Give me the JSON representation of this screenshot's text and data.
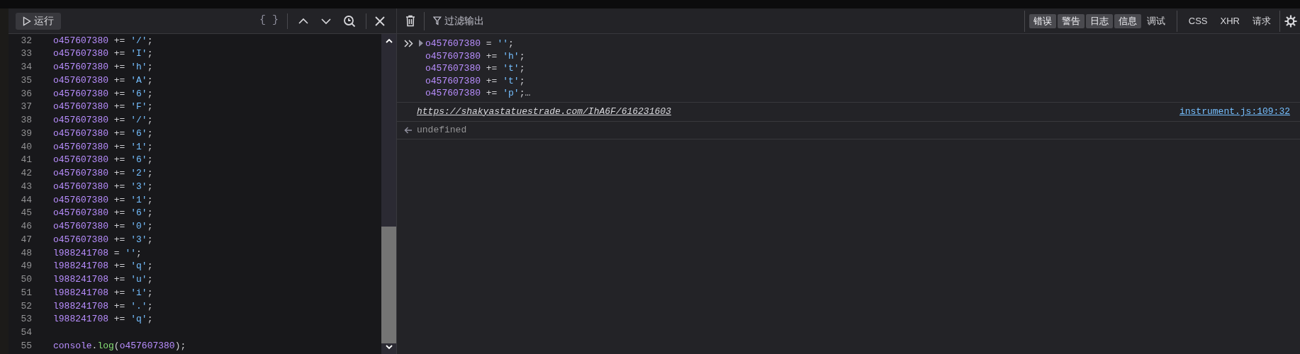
{
  "editor": {
    "run_button": "运行",
    "format_button": "{ }",
    "lines": [
      {
        "number": "32",
        "tokens": [
          {
            "text": "o457607380",
            "kind": "var"
          },
          {
            "text": " += ",
            "kind": "op"
          },
          {
            "text": "'/'",
            "kind": "str"
          },
          {
            "text": ";",
            "kind": "op"
          }
        ]
      },
      {
        "number": "33",
        "tokens": [
          {
            "text": "o457607380",
            "kind": "var"
          },
          {
            "text": " += ",
            "kind": "op"
          },
          {
            "text": "'I'",
            "kind": "str"
          },
          {
            "text": ";",
            "kind": "op"
          }
        ]
      },
      {
        "number": "34",
        "tokens": [
          {
            "text": "o457607380",
            "kind": "var"
          },
          {
            "text": " += ",
            "kind": "op"
          },
          {
            "text": "'h'",
            "kind": "str"
          },
          {
            "text": ";",
            "kind": "op"
          }
        ]
      },
      {
        "number": "35",
        "tokens": [
          {
            "text": "o457607380",
            "kind": "var"
          },
          {
            "text": " += ",
            "kind": "op"
          },
          {
            "text": "'A'",
            "kind": "str"
          },
          {
            "text": ";",
            "kind": "op"
          }
        ]
      },
      {
        "number": "36",
        "tokens": [
          {
            "text": "o457607380",
            "kind": "var"
          },
          {
            "text": " += ",
            "kind": "op"
          },
          {
            "text": "'6'",
            "kind": "str"
          },
          {
            "text": ";",
            "kind": "op"
          }
        ]
      },
      {
        "number": "37",
        "tokens": [
          {
            "text": "o457607380",
            "kind": "var"
          },
          {
            "text": " += ",
            "kind": "op"
          },
          {
            "text": "'F'",
            "kind": "str"
          },
          {
            "text": ";",
            "kind": "op"
          }
        ]
      },
      {
        "number": "38",
        "tokens": [
          {
            "text": "o457607380",
            "kind": "var"
          },
          {
            "text": " += ",
            "kind": "op"
          },
          {
            "text": "'/'",
            "kind": "str"
          },
          {
            "text": ";",
            "kind": "op"
          }
        ]
      },
      {
        "number": "39",
        "tokens": [
          {
            "text": "o457607380",
            "kind": "var"
          },
          {
            "text": " += ",
            "kind": "op"
          },
          {
            "text": "'6'",
            "kind": "str"
          },
          {
            "text": ";",
            "kind": "op"
          }
        ]
      },
      {
        "number": "40",
        "tokens": [
          {
            "text": "o457607380",
            "kind": "var"
          },
          {
            "text": " += ",
            "kind": "op"
          },
          {
            "text": "'1'",
            "kind": "str"
          },
          {
            "text": ";",
            "kind": "op"
          }
        ]
      },
      {
        "number": "41",
        "tokens": [
          {
            "text": "o457607380",
            "kind": "var"
          },
          {
            "text": " += ",
            "kind": "op"
          },
          {
            "text": "'6'",
            "kind": "str"
          },
          {
            "text": ";",
            "kind": "op"
          }
        ]
      },
      {
        "number": "42",
        "tokens": [
          {
            "text": "o457607380",
            "kind": "var"
          },
          {
            "text": " += ",
            "kind": "op"
          },
          {
            "text": "'2'",
            "kind": "str"
          },
          {
            "text": ";",
            "kind": "op"
          }
        ]
      },
      {
        "number": "43",
        "tokens": [
          {
            "text": "o457607380",
            "kind": "var"
          },
          {
            "text": " += ",
            "kind": "op"
          },
          {
            "text": "'3'",
            "kind": "str"
          },
          {
            "text": ";",
            "kind": "op"
          }
        ]
      },
      {
        "number": "44",
        "tokens": [
          {
            "text": "o457607380",
            "kind": "var"
          },
          {
            "text": " += ",
            "kind": "op"
          },
          {
            "text": "'1'",
            "kind": "str"
          },
          {
            "text": ";",
            "kind": "op"
          }
        ]
      },
      {
        "number": "45",
        "tokens": [
          {
            "text": "o457607380",
            "kind": "var"
          },
          {
            "text": " += ",
            "kind": "op"
          },
          {
            "text": "'6'",
            "kind": "str"
          },
          {
            "text": ";",
            "kind": "op"
          }
        ]
      },
      {
        "number": "46",
        "tokens": [
          {
            "text": "o457607380",
            "kind": "var"
          },
          {
            "text": " += ",
            "kind": "op"
          },
          {
            "text": "'0'",
            "kind": "str"
          },
          {
            "text": ";",
            "kind": "op"
          }
        ]
      },
      {
        "number": "47",
        "tokens": [
          {
            "text": "o457607380",
            "kind": "var"
          },
          {
            "text": " += ",
            "kind": "op"
          },
          {
            "text": "'3'",
            "kind": "str"
          },
          {
            "text": ";",
            "kind": "op"
          }
        ]
      },
      {
        "number": "48",
        "tokens": [
          {
            "text": "l988241708",
            "kind": "var"
          },
          {
            "text": " = ",
            "kind": "op"
          },
          {
            "text": "''",
            "kind": "str"
          },
          {
            "text": ";",
            "kind": "op"
          }
        ]
      },
      {
        "number": "49",
        "tokens": [
          {
            "text": "l988241708",
            "kind": "var"
          },
          {
            "text": " += ",
            "kind": "op"
          },
          {
            "text": "'q'",
            "kind": "str"
          },
          {
            "text": ";",
            "kind": "op"
          }
        ]
      },
      {
        "number": "50",
        "tokens": [
          {
            "text": "l988241708",
            "kind": "var"
          },
          {
            "text": " += ",
            "kind": "op"
          },
          {
            "text": "'u'",
            "kind": "str"
          },
          {
            "text": ";",
            "kind": "op"
          }
        ]
      },
      {
        "number": "51",
        "tokens": [
          {
            "text": "l988241708",
            "kind": "var"
          },
          {
            "text": " += ",
            "kind": "op"
          },
          {
            "text": "'i'",
            "kind": "str"
          },
          {
            "text": ";",
            "kind": "op"
          }
        ]
      },
      {
        "number": "52",
        "tokens": [
          {
            "text": "l988241708",
            "kind": "var"
          },
          {
            "text": " += ",
            "kind": "op"
          },
          {
            "text": "'.'",
            "kind": "str"
          },
          {
            "text": ";",
            "kind": "op"
          }
        ]
      },
      {
        "number": "53",
        "tokens": [
          {
            "text": "l988241708",
            "kind": "var"
          },
          {
            "text": " += ",
            "kind": "op"
          },
          {
            "text": "'q'",
            "kind": "str"
          },
          {
            "text": ";",
            "kind": "op"
          }
        ]
      },
      {
        "number": "54"
      },
      {
        "number": "55",
        "tokens": [
          {
            "text": "console",
            "kind": "var"
          },
          {
            "text": ".",
            "kind": "op"
          },
          {
            "text": "log",
            "kind": "fn"
          },
          {
            "text": "(",
            "kind": "op"
          },
          {
            "text": "o457607380",
            "kind": "var"
          },
          {
            "text": ");",
            "kind": "op"
          }
        ]
      }
    ]
  },
  "console": {
    "filter_placeholder": "过滤输出",
    "levels": [
      {
        "label": "错误",
        "selected": true
      },
      {
        "label": "警告",
        "selected": true
      },
      {
        "label": "日志",
        "selected": true
      },
      {
        "label": "信息",
        "selected": true
      },
      {
        "label": "调试",
        "selected": false
      }
    ],
    "types": [
      {
        "label": "CSS",
        "selected": false
      },
      {
        "label": "XHR",
        "selected": false
      },
      {
        "label": "请求",
        "selected": false
      }
    ],
    "entries": [
      {
        "kind": "input",
        "expanded": false,
        "lines": [
          [
            {
              "text": "o457607380",
              "kind": "var"
            },
            {
              "text": " = ",
              "kind": "op"
            },
            {
              "text": "''",
              "kind": "str"
            },
            {
              "text": ";",
              "kind": "op"
            }
          ],
          [
            {
              "text": "o457607380",
              "kind": "var"
            },
            {
              "text": " += ",
              "kind": "op"
            },
            {
              "text": "'h'",
              "kind": "str"
            },
            {
              "text": ";",
              "kind": "op"
            }
          ],
          [
            {
              "text": "o457607380",
              "kind": "var"
            },
            {
              "text": " += ",
              "kind": "op"
            },
            {
              "text": "'t'",
              "kind": "str"
            },
            {
              "text": ";",
              "kind": "op"
            }
          ],
          [
            {
              "text": "o457607380",
              "kind": "var"
            },
            {
              "text": " += ",
              "kind": "op"
            },
            {
              "text": "'t'",
              "kind": "str"
            },
            {
              "text": ";",
              "kind": "op"
            }
          ],
          [
            {
              "text": "o457607380",
              "kind": "var"
            },
            {
              "text": " += ",
              "kind": "op"
            },
            {
              "text": "'p'",
              "kind": "str"
            },
            {
              "text": ";…",
              "kind": "op"
            }
          ]
        ]
      },
      {
        "kind": "log",
        "text": "https://shakyastatuestrade.com/IhA6F/616231603",
        "source": "instrument.js:109:32"
      },
      {
        "kind": "result",
        "text": "undefined"
      }
    ]
  }
}
